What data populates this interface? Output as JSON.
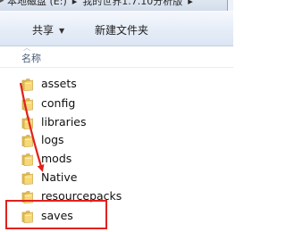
{
  "address_bar": {
    "crumbs": [
      "本地磁盘 (E:)",
      "我的世界1.7.10分析版"
    ]
  },
  "toolbar": {
    "share_label": "共享",
    "new_folder_label": "新建文件夹"
  },
  "columns": {
    "name_label": "名称"
  },
  "files": [
    {
      "name": "assets",
      "type": "folder"
    },
    {
      "name": "config",
      "type": "folder"
    },
    {
      "name": "libraries",
      "type": "folder"
    },
    {
      "name": "logs",
      "type": "folder"
    },
    {
      "name": "mods",
      "type": "folder"
    },
    {
      "name": "Native",
      "type": "folder"
    },
    {
      "name": "resourcepacks",
      "type": "folder"
    },
    {
      "name": "saves",
      "type": "folder",
      "highlighted": true
    }
  ],
  "colors": {
    "annotation": "#e2201c",
    "folder_body": "#e9c25a",
    "folder_front": "#f6d877"
  }
}
